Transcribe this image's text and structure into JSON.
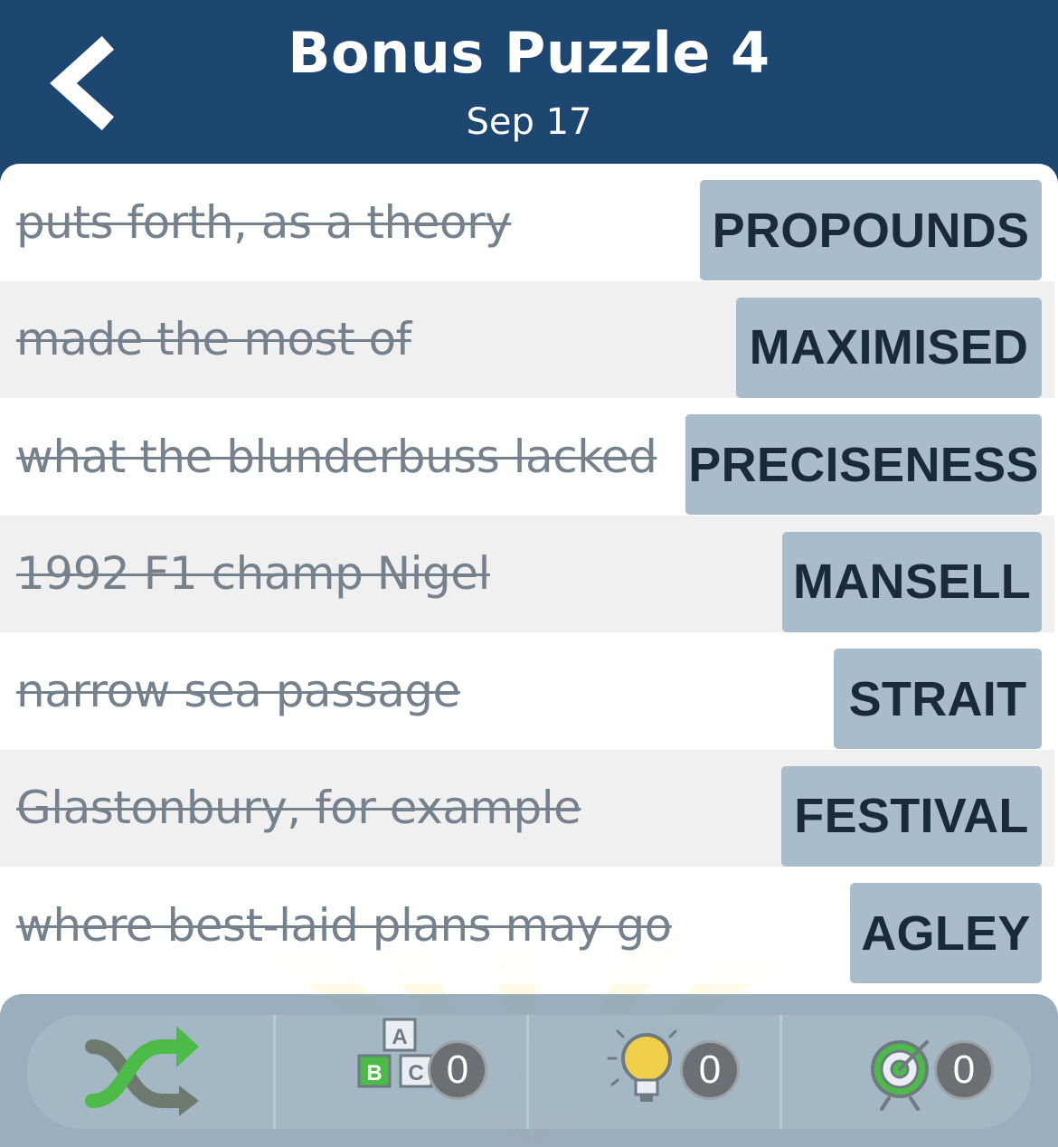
{
  "header": {
    "title": "Bonus Puzzle 4",
    "date": "Sep 17"
  },
  "clues": [
    {
      "clue": "puts forth, as a theory",
      "answer": "PROPOUNDS"
    },
    {
      "clue": "made the most of",
      "answer": "MAXIMISED"
    },
    {
      "clue": "what the blunderbuss lacked",
      "answer": "PRECISENESS"
    },
    {
      "clue": "1992 F1 champ Nigel",
      "answer": "MANSELL"
    },
    {
      "clue": "narrow sea passage",
      "answer": "STRAIT"
    },
    {
      "clue": "Glastonbury, for example",
      "answer": "FESTIVAL"
    },
    {
      "clue": "where best-laid plans may go",
      "answer": "AGLEY"
    }
  ],
  "toolbar": {
    "letters_icon_text": [
      "A",
      "B",
      "C"
    ],
    "letters_count": "0",
    "hint_count": "0",
    "target_count": "0"
  },
  "colors": {
    "header_bg": "#1d4671",
    "answer_tile": "#a9bccb",
    "clue_text": "#75828d",
    "shuffle_green": "#4cbb47",
    "shuffle_gray": "#6f7a6f"
  }
}
